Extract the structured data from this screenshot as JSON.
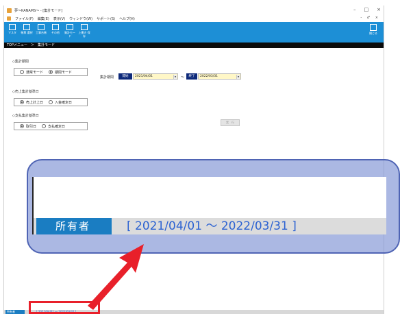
{
  "window": {
    "title": "夢～KANAMS～ - [集計モード]",
    "controls": [
      "–",
      "□",
      "×"
    ]
  },
  "menubar": {
    "items": [
      "ファイル(F)",
      "編集(E)",
      "表示(V)",
      "ウィンドウ(W)",
      "サポート(S)",
      "ヘルプ(H)"
    ],
    "mdi_controls": "- ♂ ×"
  },
  "toolbar": {
    "items": [
      {
        "label": "マスタ",
        "icon": "master-icon"
      },
      {
        "label": "帳票\n選択",
        "icon": "report-icon"
      },
      {
        "label": "工事台帳",
        "icon": "ledger-icon"
      },
      {
        "label": "その他",
        "icon": "more-icon"
      },
      {
        "label": "集計モード",
        "icon": "summary-icon"
      },
      {
        "label": "上書き\n保存",
        "icon": "save-icon"
      }
    ],
    "exit_label": "閉じる"
  },
  "breadcrumb": "TOPメニュー　＞　集計モード",
  "sections": {
    "period": {
      "label": "◇集計期間",
      "options": [
        "通常モード",
        "期間モード"
      ],
      "selected": 1
    },
    "sales": {
      "label": "◇売上集計基準日",
      "options": [
        "売上計上日",
        "入金確定日"
      ],
      "selected": 0
    },
    "payment": {
      "label": "◇支払集計基準日",
      "options": [
        "取引日",
        "支払確定日"
      ],
      "selected": 0
    }
  },
  "period_range": {
    "label": "集計期間",
    "start_tag": "開始",
    "start_date": "2021/04/01",
    "separator": "～",
    "end_tag": "終了",
    "end_date": "2022/03/31"
  },
  "run_button": "実　行",
  "statusbar": {
    "owner_label": "所有者",
    "range_text": "[ 2021/04/01 ～ 2022/03/31 ]"
  },
  "zoom": {
    "owner_label": "所有者",
    "range_text": "[ 2021/04/01 ～ 2022/03/31 ]"
  },
  "colors": {
    "toolbar": "#1d8fd6",
    "tag": "#0e2a7a",
    "date_field": "#fff7c7",
    "highlight": "#e8202a",
    "callout": "#788cd2"
  }
}
